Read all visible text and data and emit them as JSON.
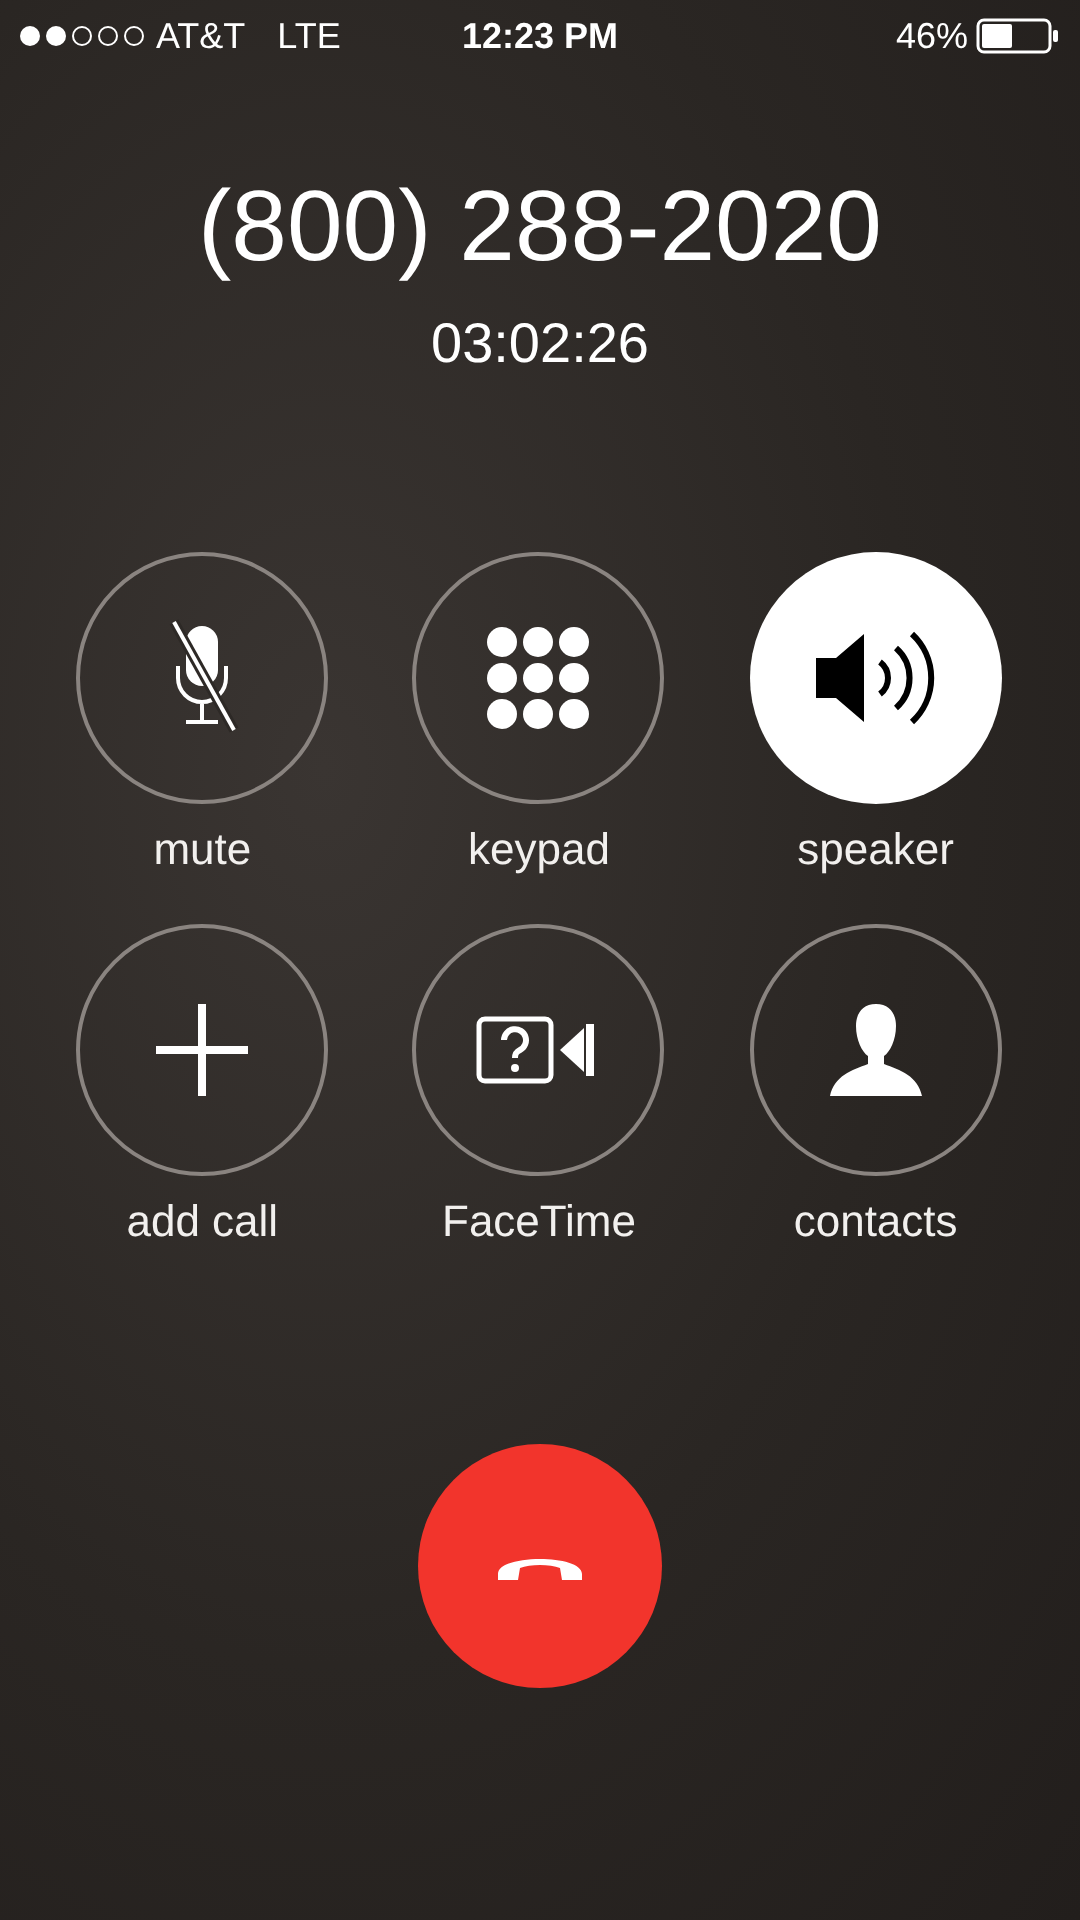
{
  "status_bar": {
    "signal_dots": [
      {
        "filled": true
      },
      {
        "filled": true
      },
      {
        "filled": false
      },
      {
        "filled": false
      },
      {
        "filled": false
      }
    ],
    "carrier": "AT&T",
    "network": "LTE",
    "time": "12:23 PM",
    "battery": "46%"
  },
  "call": {
    "number": "(800) 288-2020",
    "duration": "03:02:26"
  },
  "buttons": [
    {
      "kind": "mute",
      "label": "mute",
      "selected": false
    },
    {
      "kind": "keypad",
      "label": "keypad",
      "selected": false
    },
    {
      "kind": "speaker",
      "label": "speaker",
      "selected": true
    },
    {
      "kind": "add",
      "label": "add call",
      "selected": false
    },
    {
      "kind": "facetime",
      "label": "FaceTime",
      "selected": false
    },
    {
      "kind": "contacts",
      "label": "contacts",
      "selected": false
    }
  ]
}
